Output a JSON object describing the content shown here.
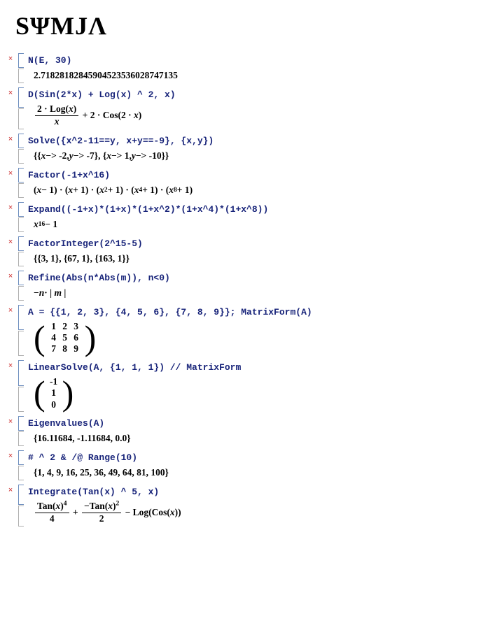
{
  "brand": {
    "title": "SΨMJΛ"
  },
  "close_glyph": "×",
  "cells": [
    {
      "input": "N(E, 30)",
      "output_plain": "2.71828182845904523536028747135"
    },
    {
      "input": "D(Sin(2*x) + Log(x) ^ 2, x)",
      "output_html": "<span class='frac'><span class='num'>2 · Log(<span class='varx'>x</span>)</span><span class='den'><span class='varx'>x</span></span></span><span>&nbsp;+ 2 · Cos(2 · <span class='varx'>x</span>)</span>"
    },
    {
      "input": "Solve({x^2-11==y, x+y==-9}, {x,y})",
      "output_html": "{{<span class='varx'>x</span> −> -2, <span class='varx'>y</span> −> -7}, {<span class='varx'>x</span> −> 1, <span class='varx'>y</span> −> -10}}"
    },
    {
      "input": "Factor(-1+x^16)",
      "output_html": "(<span class='varx'>x</span> − 1) · (<span class='varx'>x</span> + 1) · (<span class='varx'>x</span><sup>2</sup> + 1) · (<span class='varx'>x</span><sup>4</sup> + 1) · (<span class='varx'>x</span><sup>8</sup> + 1)"
    },
    {
      "input": "Expand((-1+x)*(1+x)*(1+x^2)*(1+x^4)*(1+x^8))",
      "output_html": "<span class='varx'>x</span><sup>16</sup> − 1"
    },
    {
      "input": "FactorInteger(2^15-5)",
      "output_plain": "{{3, 1}, {67, 1}, {163, 1}}"
    },
    {
      "input": "Refine(Abs(n*Abs(m)), n<0)",
      "output_html": "−<span class='varx'>n</span>·&nbsp;|&nbsp;<span class='varx'>m</span>&nbsp;|"
    },
    {
      "input": "A = {{1, 2, 3}, {4, 5, 6}, {7, 8, 9}}; MatrixForm(A)",
      "output_matrix": [
        [
          "1",
          "2",
          "3"
        ],
        [
          "4",
          "5",
          "6"
        ],
        [
          "7",
          "8",
          "9"
        ]
      ]
    },
    {
      "input": "LinearSolve(A, {1, 1, 1}) // MatrixForm",
      "output_matrix": [
        [
          "-1"
        ],
        [
          "1"
        ],
        [
          "0"
        ]
      ]
    },
    {
      "input": "Eigenvalues(A)",
      "output_plain": "{16.11684, -1.11684, 0.0}"
    },
    {
      "input": "# ^ 2 & /@ Range(10)",
      "output_plain": "{1, 4, 9, 16, 25, 36, 49, 64, 81, 100}"
    },
    {
      "input": "Integrate(Tan(x) ^ 5, x)",
      "output_html": "<span class='frac'><span class='num'>Tan(<span class='varx'>x</span>)<sup>4</sup></span><span class='den'>4</span></span><span>&nbsp;+&nbsp;</span><span class='frac'><span class='num'>−Tan(<span class='varx'>x</span>)<sup>2</sup></span><span class='den'>2</span></span><span>&nbsp;− Log(Cos(<span class='varx'>x</span>))</span>"
    }
  ]
}
